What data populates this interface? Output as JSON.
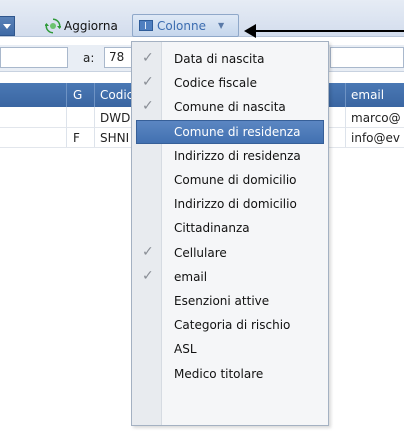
{
  "toolbar": {
    "refresh_label": "Aggiorna",
    "columns_label": "Colonne"
  },
  "filter": {
    "to_label": "a:",
    "to_value": "78"
  },
  "grid": {
    "headers": [
      "G",
      "Codic",
      "email"
    ],
    "rows": [
      {
        "g": "",
        "codice": "DWD",
        "email": "marco@"
      },
      {
        "g": "F",
        "codice": "SHNI",
        "email": "info@ev"
      }
    ]
  },
  "menu": {
    "items": [
      {
        "label": "Data di nascita",
        "checked": true
      },
      {
        "label": "Codice fiscale",
        "checked": true
      },
      {
        "label": "Comune di nascita",
        "checked": true
      },
      {
        "label": "Comune di residenza",
        "checked": false,
        "highlighted": true
      },
      {
        "label": "Indirizzo di residenza",
        "checked": false
      },
      {
        "label": "Comune di domicilio",
        "checked": false
      },
      {
        "label": "Indirizzo di domicilio",
        "checked": false
      },
      {
        "label": "Cittadinanza",
        "checked": false
      },
      {
        "label": "Cellulare",
        "checked": true
      },
      {
        "label": "email",
        "checked": true
      },
      {
        "label": "Esenzioni attive",
        "checked": false
      },
      {
        "label": "Categoria di rischio",
        "checked": false
      },
      {
        "label": "ASL",
        "checked": false
      },
      {
        "label": "Medico titolare",
        "checked": false
      }
    ]
  },
  "colors": {
    "accent": "#4a78b4",
    "highlight": "#4f7dbd",
    "check": "#8a8f96"
  }
}
